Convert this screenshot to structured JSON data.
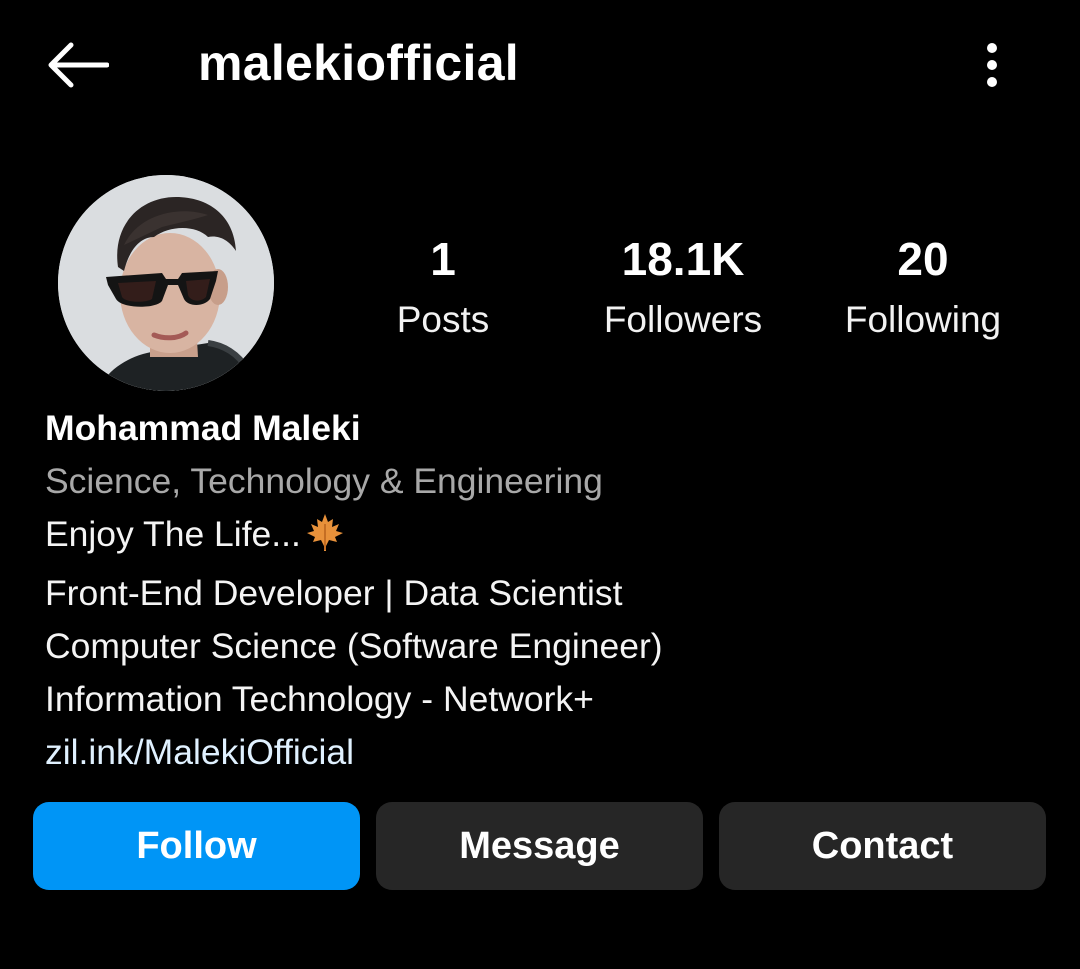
{
  "header": {
    "username": "malekiofficial",
    "back_icon": "arrow-left-icon",
    "more_icon": "more-vertical-icon"
  },
  "profile": {
    "avatar_description": "profile-photo"
  },
  "stats": [
    {
      "count": "1",
      "label": "Posts"
    },
    {
      "count": "18.1K",
      "label": "Followers"
    },
    {
      "count": "20",
      "label": "Following"
    }
  ],
  "bio": {
    "name": "Mohammad Maleki",
    "category": "Science, Technology & Engineering",
    "line1": "Enjoy The Life...",
    "line1_emoji": "maple-leaf-icon",
    "line2": "Front-End Developer | Data Scientist",
    "line3": "Computer Science (Software Engineer)",
    "line4": "Information Technology - Network+",
    "link": "zil.ink/MalekiOfficial"
  },
  "actions": {
    "follow": "Follow",
    "message": "Message",
    "contact": "Contact"
  },
  "colors": {
    "background": "#000000",
    "follow_button": "#0095f6",
    "secondary_button": "#262626",
    "category_text": "#a8a8a8",
    "link_text": "#e0f1ff"
  }
}
